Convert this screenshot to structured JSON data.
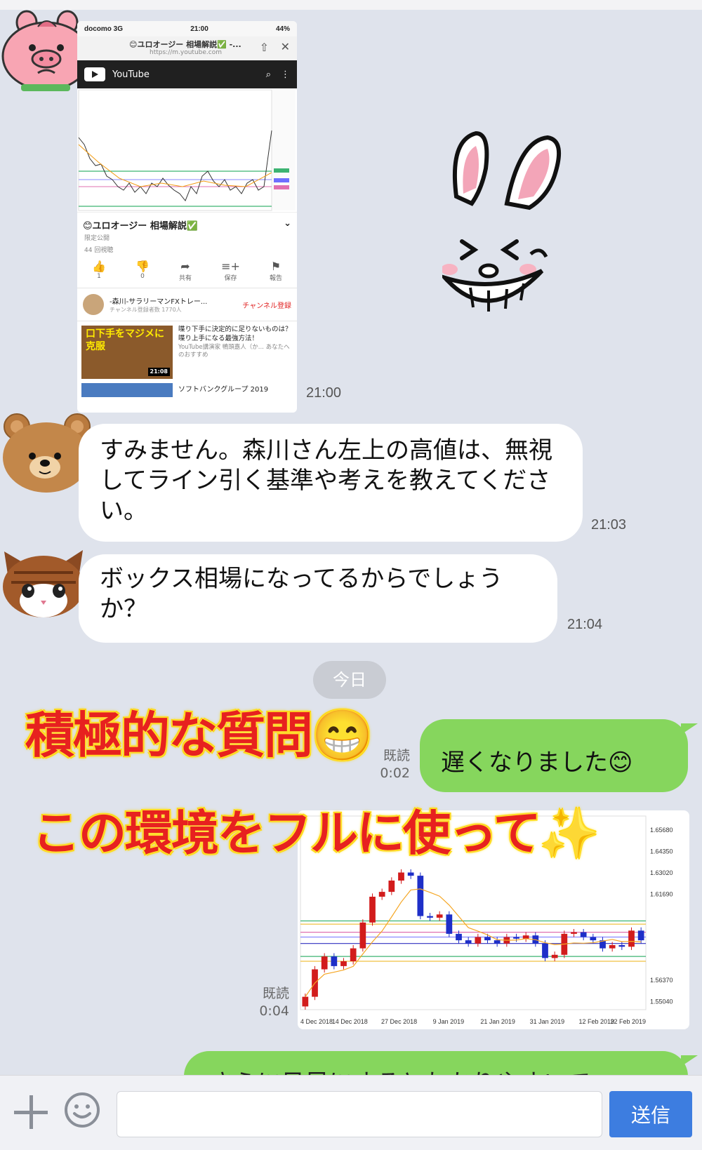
{
  "screenshot": {
    "carrier": "docomo 3G",
    "clock": "21:00",
    "battery": "44%",
    "page_title": "😊ユロオージー 相場解説✅ -...",
    "page_url": "https://m.youtube.com",
    "youtube_label": "YouTube",
    "video_title": "😊ユロオージー 相場解説✅",
    "privacy": "限定公開",
    "views": "44 回視聴",
    "actions": [
      {
        "icon": "👍",
        "label": "1"
      },
      {
        "icon": "👎",
        "label": "0"
      },
      {
        "icon": "➦",
        "label": "共有"
      },
      {
        "icon": "≡+",
        "label": "保存"
      },
      {
        "icon": "⚑",
        "label": "報告"
      }
    ],
    "channel_name": "-森川-サラリーマンFXトレー...",
    "channel_subs": "チャンネル登録者数 1770人",
    "subscribe_label": "チャンネル登録",
    "rec_thumb_text": "口下手をマジメに克服",
    "rec_duration": "21:08",
    "rec_title": "喋り下手に決定的に足りないものは？喋り上手になる最強方法！",
    "rec_sub": "YouTube講演家 鴨頭嘉人（か... あなたへのおすすめ",
    "rec2_title": "ソフトバンクグループ 2019"
  },
  "messages": {
    "t1": "21:00",
    "m2": "すみません。森川さん左上の高値は、無視してライン引く基準や考えを教えてください。",
    "t2": "21:03",
    "m3": "ボックス相場になってるからでしょうか？",
    "t3": "21:04",
    "day_pill": "今日",
    "read1": "既読",
    "read1_time": "0:02",
    "m4": "遅くなりました😊",
    "read2": "既読",
    "read2_time": "0:04",
    "m5": "さらに日足にするとわかりやすいで"
  },
  "captions": {
    "c1": "積極的な質問😁",
    "c2": "この環境をフルに使って✨"
  },
  "chart": {
    "y_labels": [
      "1.65680",
      "1.64350",
      "1.63020",
      "1.61690",
      "1.56370",
      "1.55040"
    ],
    "x_labels": [
      "4 Dec 2018",
      "14 Dec 2018",
      "27 Dec 2018",
      "9 Jan 2019",
      "21 Jan 2019",
      "31 Jan 2019",
      "12 Feb 2019",
      "22 Feb 2019"
    ]
  },
  "chart_data": {
    "type": "candlestick",
    "x": [
      "4 Dec 2018",
      "14 Dec 2018",
      "27 Dec 2018",
      "9 Jan 2019",
      "21 Jan 2019",
      "31 Jan 2019",
      "12 Feb 2019",
      "22 Feb 2019"
    ],
    "ylim": [
      1.545,
      1.665
    ],
    "closes": [
      1.553,
      1.57,
      1.578,
      1.572,
      1.575,
      1.583,
      1.599,
      1.615,
      1.618,
      1.625,
      1.63,
      1.628,
      1.603,
      1.602,
      1.604,
      1.592,
      1.588,
      1.586,
      1.59,
      1.588,
      1.586,
      1.59,
      1.589,
      1.591,
      1.586,
      1.577,
      1.579,
      1.592,
      1.593,
      1.59,
      1.588,
      1.583,
      1.585,
      1.584,
      1.594,
      1.588
    ]
  },
  "input": {
    "placeholder": "",
    "send_label": "送信"
  }
}
